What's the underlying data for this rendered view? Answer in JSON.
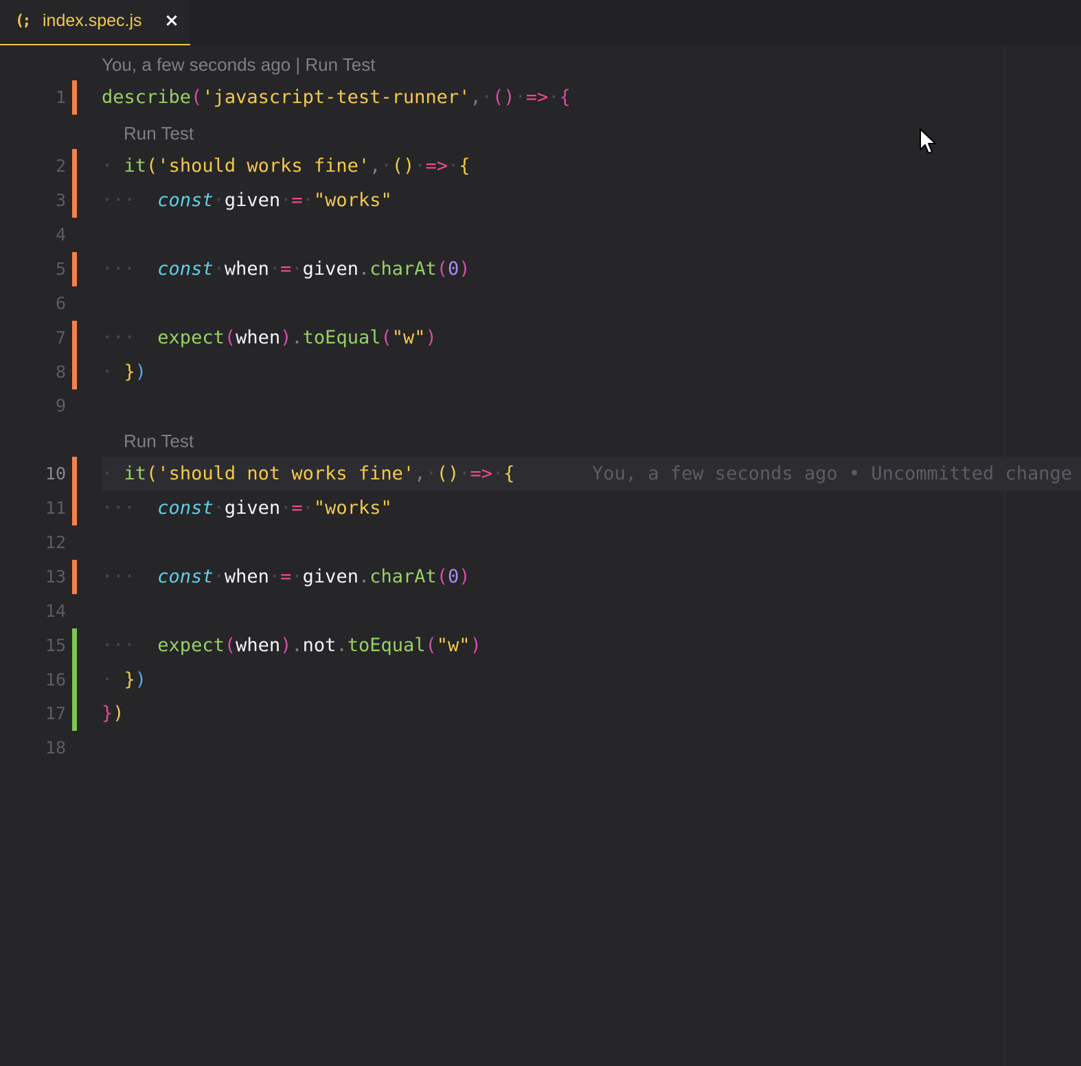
{
  "tab": {
    "icon": "(;",
    "icon_name": "javascript-file-icon",
    "title": "index.spec.js",
    "close": "×"
  },
  "codelens": {
    "top_author": "You, a few seconds ago",
    "separator": " | ",
    "run_test": "Run Test"
  },
  "blame": {
    "line": 10,
    "text": "You, a few seconds ago • Uncommitted change"
  },
  "lines": [
    {
      "n": "1",
      "gutter": "modified"
    },
    {
      "n": "2",
      "gutter": "modified"
    },
    {
      "n": "3",
      "gutter": "modified"
    },
    {
      "n": "4",
      "gutter": "none"
    },
    {
      "n": "5",
      "gutter": "modified"
    },
    {
      "n": "6",
      "gutter": "none"
    },
    {
      "n": "7",
      "gutter": "modified"
    },
    {
      "n": "8",
      "gutter": "modified"
    },
    {
      "n": "9",
      "gutter": "none"
    },
    {
      "n": "10",
      "gutter": "modified"
    },
    {
      "n": "11",
      "gutter": "modified"
    },
    {
      "n": "12",
      "gutter": "none"
    },
    {
      "n": "13",
      "gutter": "modified"
    },
    {
      "n": "14",
      "gutter": "none"
    },
    {
      "n": "15",
      "gutter": "added"
    },
    {
      "n": "16",
      "gutter": "added"
    },
    {
      "n": "17",
      "gutter": "added"
    },
    {
      "n": "18",
      "gutter": "none"
    }
  ],
  "code": {
    "describe": "describe",
    "describe_name": "'javascript-test-runner'",
    "it": "it",
    "test1_name": "'should works fine'",
    "test2_name": "'should not works fine'",
    "const": "const",
    "given": "given",
    "when": "when",
    "works": "\"works\"",
    "charAt": "charAt",
    "zero": "0",
    "expect": "expect",
    "not": "not",
    "toEqual": "toEqual",
    "w": "\"w\""
  },
  "colors": {
    "background": "#262528",
    "accent_yellow": "#f2c94c",
    "gutter_modified": "#f0834b",
    "gutter_added": "#7dc651"
  },
  "mouse_cursor_icon": "mouse-pointer-icon"
}
